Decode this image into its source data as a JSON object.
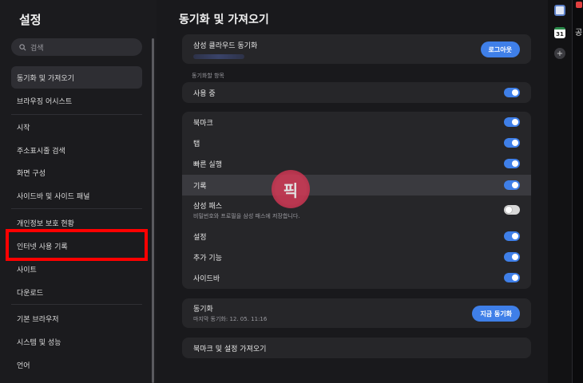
{
  "sidebar": {
    "title": "설정",
    "search_placeholder": "검색",
    "items": [
      {
        "label": "동기화 및 가져오기",
        "active": true
      },
      {
        "label": "브라우징 어시스트"
      },
      {
        "label": "시작"
      },
      {
        "label": "주소표시줄 검색"
      },
      {
        "label": "화면 구성"
      },
      {
        "label": "사이드바 및 사이드 패널"
      },
      {
        "label": "개인정보 보호 현황"
      },
      {
        "label": "인터넷 사용 기록"
      },
      {
        "label": "사이트"
      },
      {
        "label": "다운로드"
      },
      {
        "label": "기본 브라우저"
      },
      {
        "label": "시스템 및 성능"
      },
      {
        "label": "언어"
      }
    ]
  },
  "main": {
    "title": "동기화 및 가져오기",
    "account": {
      "label": "삼성 클라우드 동기화",
      "logout_label": "로그아웃"
    },
    "section_label": "동기화할 항목",
    "in_use": {
      "label": "사용 중",
      "enabled": true
    },
    "items": [
      {
        "label": "북마크",
        "enabled": true
      },
      {
        "label": "탭",
        "enabled": true
      },
      {
        "label": "빠른 실행",
        "enabled": true
      },
      {
        "label": "기록",
        "enabled": true
      },
      {
        "label": "삼성 패스",
        "sub": "비밀번호와 프로필을 삼성 패스에 저장합니다.",
        "enabled": false
      },
      {
        "label": "설정",
        "enabled": true
      },
      {
        "label": "추가 기능",
        "enabled": true
      },
      {
        "label": "사이드바",
        "enabled": true
      }
    ],
    "sync": {
      "label": "동기화",
      "last": "마지막 동기화: 12. 05. 11:16",
      "button": "지금 동기화"
    },
    "import": {
      "label": "북마크 및 설정 가져오기"
    }
  },
  "right_strip": {
    "calendar_day": "31",
    "edge_text": "공"
  },
  "watermark": {
    "text": "픽"
  },
  "colors": {
    "accent": "#3f7fe8",
    "highlight": "#ff0000",
    "background": "#19191c",
    "card": "#262629"
  }
}
